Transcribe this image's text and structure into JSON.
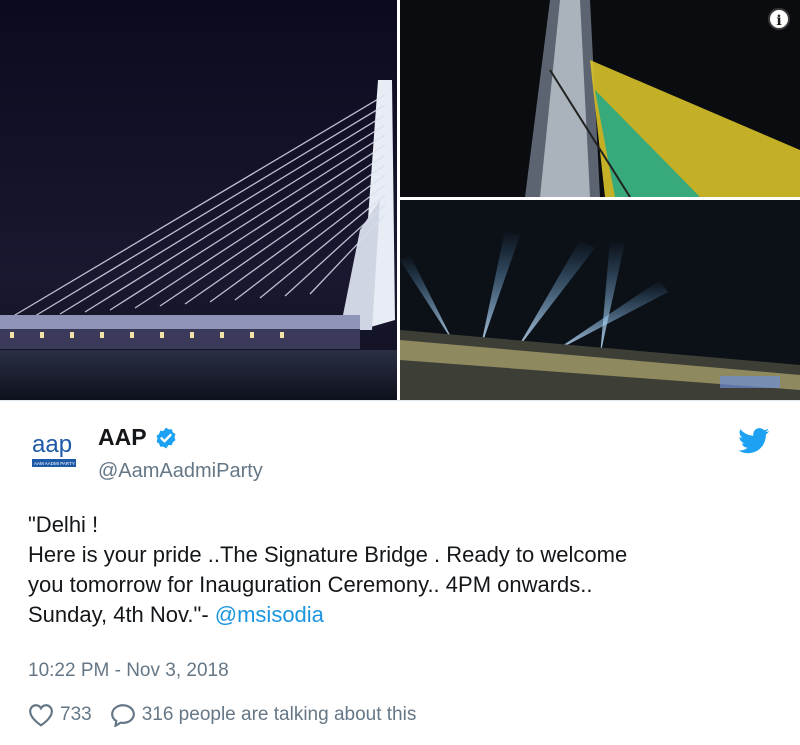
{
  "media": {
    "info_icon_label": "i"
  },
  "tweet": {
    "display_name": "AAP",
    "handle": "@AamAadmiParty",
    "avatar": {
      "logo_text": "aap",
      "logo_subtext": "AAM AADMI PARTY"
    },
    "text_lines": [
      "\"Delhi !",
      "Here is your pride ..The Signature Bridge . Ready to welcome",
      "you tomorrow for Inauguration Ceremony.. 4PM onwards..",
      "Sunday, 4th Nov.\"- "
    ],
    "mention": "@msisodia",
    "timestamp": "10:22 PM - Nov 3, 2018",
    "likes": "733",
    "talking": "316 people are talking about this"
  },
  "colors": {
    "verified": "#1da1f2",
    "twitter_bird": "#1da1f2",
    "mention": "#1b95e0",
    "secondary_text": "#657786"
  },
  "icons": [
    "info-icon",
    "verified-badge-icon",
    "twitter-bird-icon",
    "heart-icon",
    "comment-icon"
  ]
}
